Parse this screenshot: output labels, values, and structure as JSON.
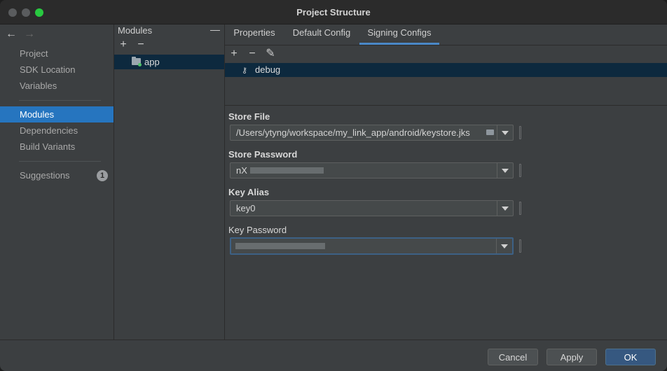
{
  "window": {
    "title": "Project Structure"
  },
  "nav": {
    "back_icon": "arrow-left-icon",
    "forward_icon": "arrow-right-icon",
    "items": [
      {
        "label": "Project"
      },
      {
        "label": "SDK Location"
      },
      {
        "label": "Variables"
      },
      {
        "label": "Modules"
      },
      {
        "label": "Dependencies"
      },
      {
        "label": "Build Variants"
      },
      {
        "label": "Suggestions",
        "badge": "1"
      }
    ],
    "selected": "Modules"
  },
  "modules": {
    "header": "Modules",
    "collapse_glyph": "—",
    "add_glyph": "+",
    "remove_glyph": "−",
    "items": [
      {
        "label": "app"
      }
    ]
  },
  "tabs": [
    {
      "label": "Properties"
    },
    {
      "label": "Default Config"
    },
    {
      "label": "Signing Configs"
    }
  ],
  "active_tab": "Signing Configs",
  "signing": {
    "add_glyph": "+",
    "remove_glyph": "−",
    "edit_glyph": "✎",
    "configs": [
      {
        "label": "debug"
      }
    ]
  },
  "form": {
    "store_file_label": "Store File",
    "store_file_value": "/Users/ytyng/workspace/my_link_app/android/keystore.jks",
    "store_password_label": "Store Password",
    "store_password_value": "nX",
    "key_alias_label": "Key Alias",
    "key_alias_value": "key0",
    "key_password_label": "Key Password",
    "key_password_value": ""
  },
  "footer": {
    "cancel_label": "Cancel",
    "apply_label": "Apply",
    "ok_label": "OK"
  },
  "colors": {
    "accent": "#2675bf",
    "selection_dark": "#0d293e",
    "primary_button": "#365880"
  }
}
